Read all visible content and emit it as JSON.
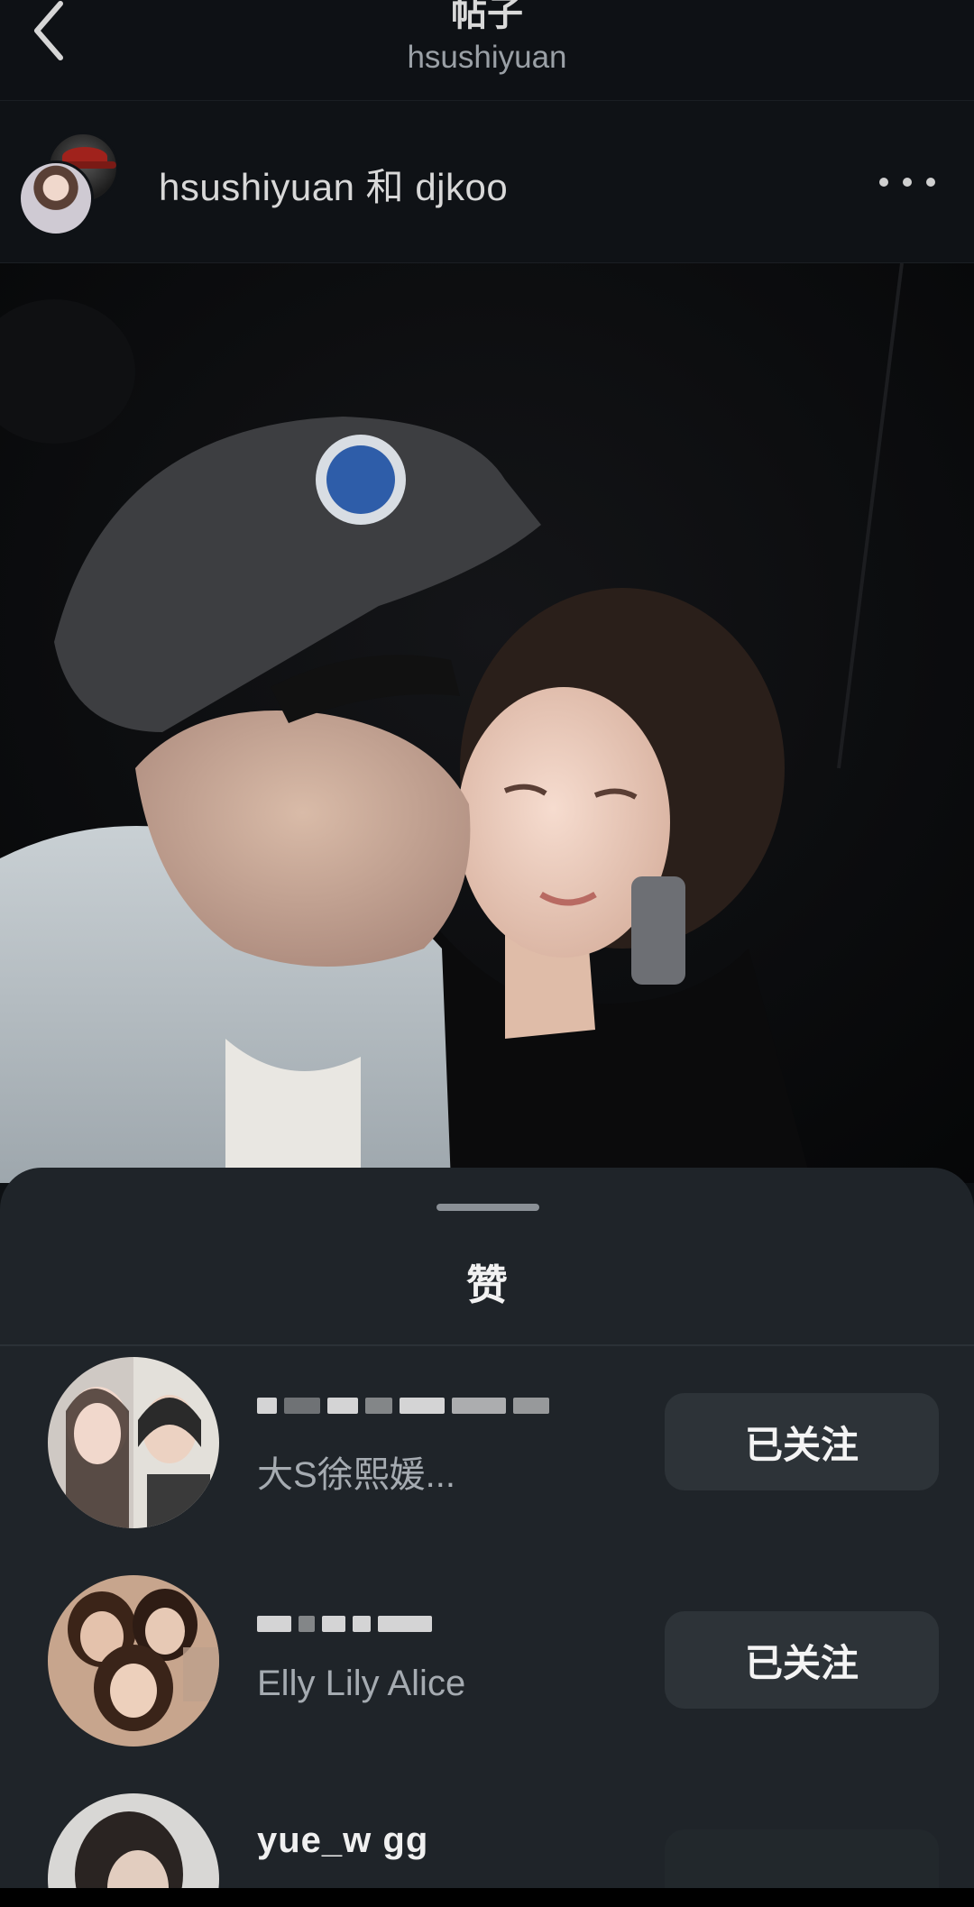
{
  "header": {
    "title": "帖子",
    "subtitle": "hsushiyuan"
  },
  "post": {
    "authors": "hsushiyuan 和 djkoo",
    "more_icon": "more-horizontal-icon"
  },
  "likes_sheet": {
    "title": "赞",
    "users": [
      {
        "username": "",
        "display_name": "大S徐熙媛...",
        "button": "已关注"
      },
      {
        "username": "",
        "display_name": "Elly Lily Alice",
        "button": "已关注"
      },
      {
        "username": "yue_w  gg",
        "display_name": "",
        "button": ""
      }
    ]
  },
  "colors": {
    "background": "#0d1013",
    "sheet": "#1f2429",
    "button": "#2d3338",
    "text_primary": "#f0f0f0",
    "text_secondary": "#a5abb1"
  }
}
